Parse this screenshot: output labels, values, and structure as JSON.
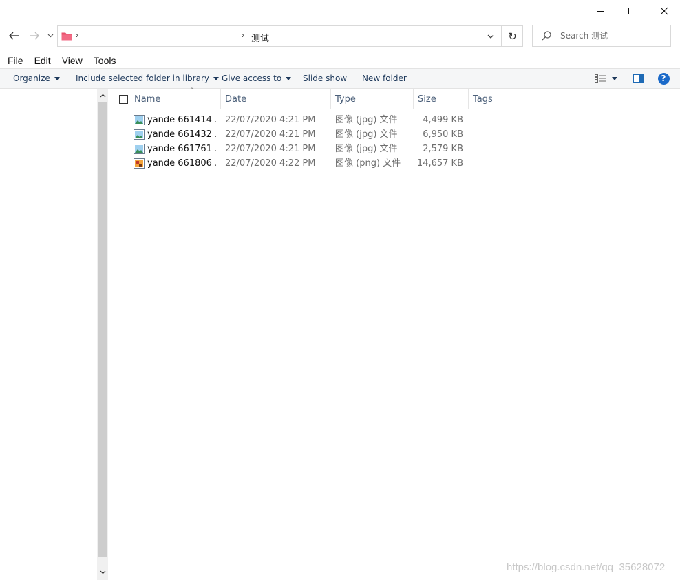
{
  "window": {
    "minimize_glyph": "—",
    "close_glyph": "✕"
  },
  "nav": {
    "back_icon": "arrow-left-icon",
    "forward_icon": "arrow-right-icon",
    "recent_icon": "chevron-down-icon"
  },
  "address": {
    "separator": "›",
    "crumb": "测试",
    "refresh_glyph": "↻"
  },
  "search": {
    "placeholder": "Search 测试"
  },
  "menu": {
    "items": [
      "File",
      "Edit",
      "View",
      "Tools"
    ]
  },
  "commands": {
    "organize": "Organize",
    "include": "Include selected folder in library",
    "give_access": "Give access to",
    "slide_show": "Slide show",
    "new_folder": "New folder",
    "help": "?"
  },
  "columns": {
    "name": "Name",
    "date": "Date",
    "type": "Type",
    "size": "Size",
    "tags": "Tags",
    "sort_indicator": "^"
  },
  "files": [
    {
      "name": "yande 661414 ...",
      "date": "22/07/2020 4:21 PM",
      "type": "图像 (jpg) 文件",
      "size": "4,499 KB",
      "icon": "jpg-image-icon"
    },
    {
      "name": "yande 661432 ...",
      "date": "22/07/2020 4:21 PM",
      "type": "图像 (jpg) 文件",
      "size": "6,950 KB",
      "icon": "jpg-image-icon"
    },
    {
      "name": "yande 661761 ...",
      "date": "22/07/2020 4:21 PM",
      "type": "图像 (jpg) 文件",
      "size": "2,579 KB",
      "icon": "jpg-image-icon"
    },
    {
      "name": "yande 661806 ...",
      "date": "22/07/2020 4:22 PM",
      "type": "图像 (png) 文件",
      "size": "14,657 KB",
      "icon": "png-image-icon"
    }
  ],
  "watermark": "https://blog.csdn.net/qq_35628072",
  "colors": {
    "accent": "#1b6ac9",
    "command_text": "#1e395b",
    "folder_pink": "#e8516d"
  }
}
